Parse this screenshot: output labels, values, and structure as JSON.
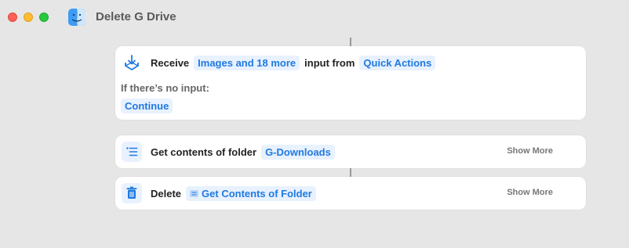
{
  "window": {
    "title": "Delete G Drive",
    "app_icon": "finder-icon"
  },
  "actions": [
    {
      "icon": "receive-download-icon",
      "verb": "Receive",
      "input_token": "Images and 18 more",
      "middle": "input from",
      "source_token": "Quick Actions",
      "no_input_label": "If there’s no input:",
      "no_input_value": "Continue"
    },
    {
      "icon": "list-icon",
      "label": "Get contents of folder",
      "token": "G-Downloads",
      "show_more": "Show More"
    },
    {
      "icon": "trash-icon",
      "label": "Delete",
      "token": "Get Contents of Folder",
      "show_more": "Show More"
    }
  ],
  "colors": {
    "accent": "#1f7ae0",
    "token_bg": "#e8f1fe",
    "background": "#e6e6e6"
  }
}
